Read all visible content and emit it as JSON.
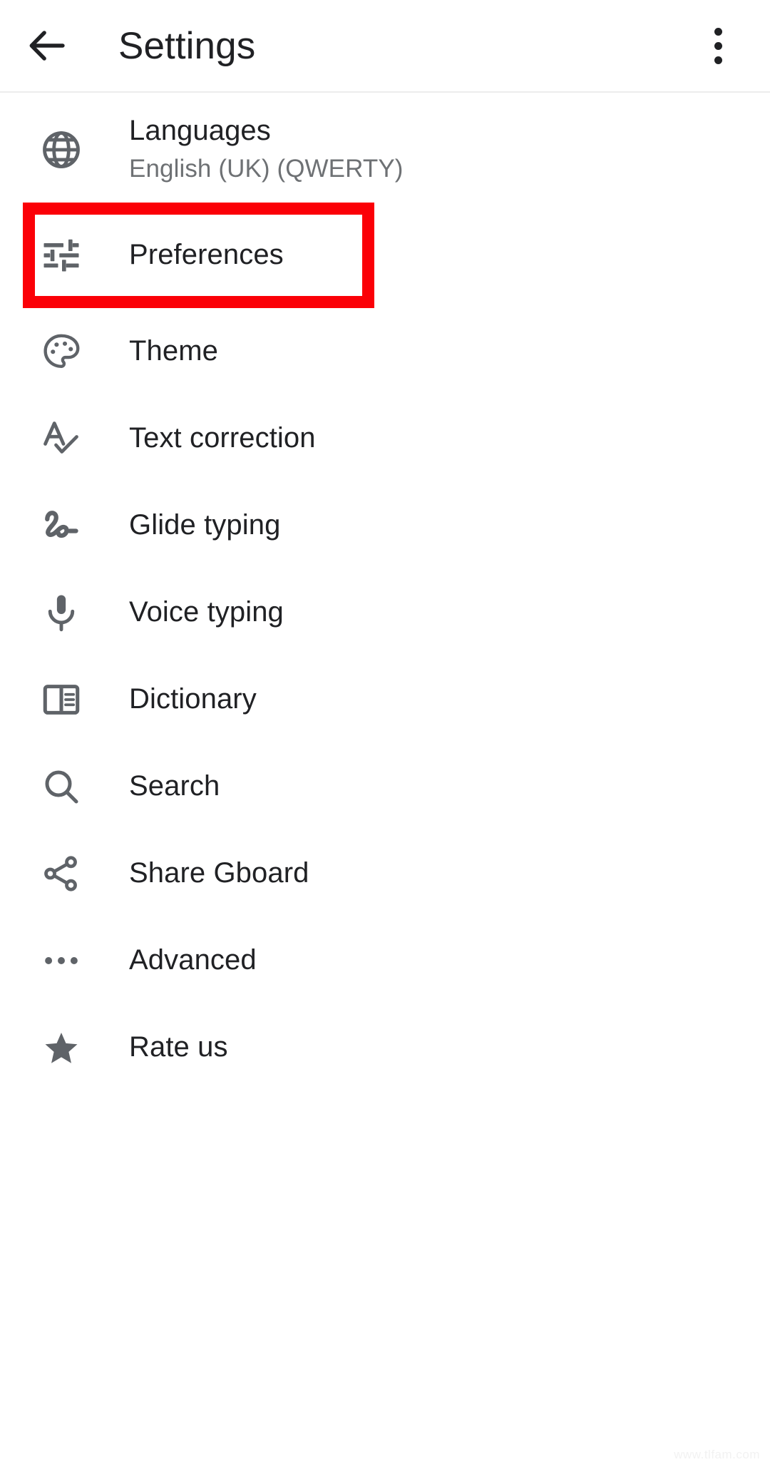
{
  "appbar": {
    "back_icon": "arrow-back-icon",
    "title": "Settings",
    "overflow_icon": "more-vert-icon"
  },
  "colors": {
    "highlight": "#fb0007",
    "title_text": "#202124",
    "subtitle_text": "#6e7174",
    "icon": "#5f6368",
    "background": "#ffffff",
    "divider": "#eceded"
  },
  "list": {
    "items": [
      {
        "icon": "globe-icon",
        "label": "Languages",
        "subtitle": "English (UK) (QWERTY)",
        "highlighted": false
      },
      {
        "icon": "tune-sliders-icon",
        "label": "Preferences",
        "subtitle": "",
        "highlighted": true
      },
      {
        "icon": "palette-icon",
        "label": "Theme",
        "subtitle": "",
        "highlighted": false
      },
      {
        "icon": "spellcheck-icon",
        "label": "Text correction",
        "subtitle": "",
        "highlighted": false
      },
      {
        "icon": "gesture-icon",
        "label": "Glide typing",
        "subtitle": "",
        "highlighted": false
      },
      {
        "icon": "microphone-icon",
        "label": "Voice typing",
        "subtitle": "",
        "highlighted": false
      },
      {
        "icon": "dictionary-book-icon",
        "label": "Dictionary",
        "subtitle": "",
        "highlighted": false
      },
      {
        "icon": "search-icon",
        "label": "Search",
        "subtitle": "",
        "highlighted": false
      },
      {
        "icon": "share-icon",
        "label": "Share Gboard",
        "subtitle": "",
        "highlighted": false
      },
      {
        "icon": "more-horiz-icon",
        "label": "Advanced",
        "subtitle": "",
        "highlighted": false
      },
      {
        "icon": "star-icon",
        "label": "Rate us",
        "subtitle": "",
        "highlighted": false
      }
    ]
  },
  "watermark": "www.tlfam.com"
}
